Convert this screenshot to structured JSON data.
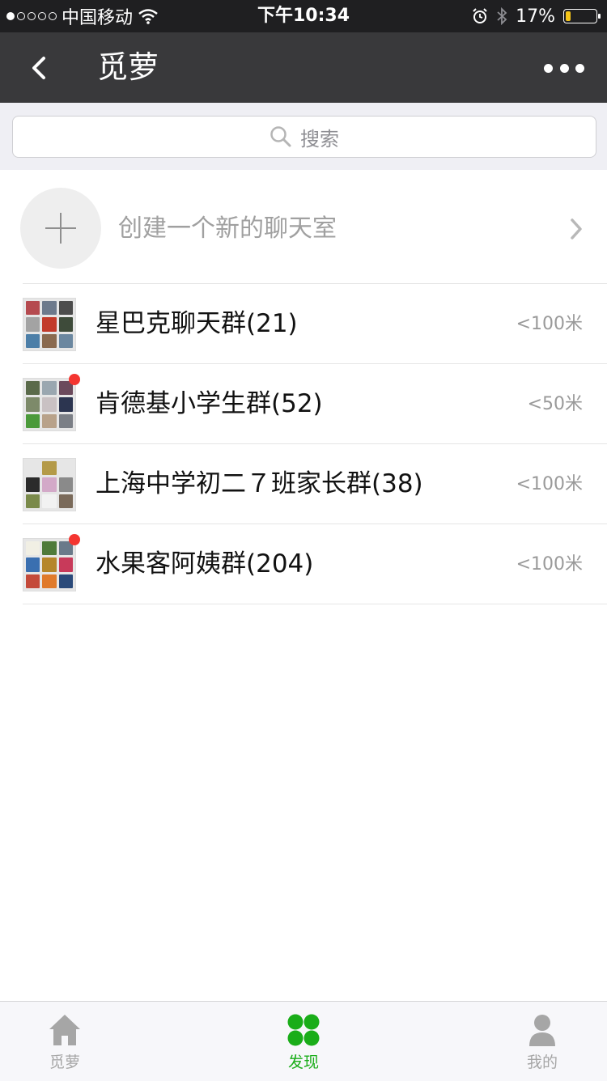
{
  "status_bar": {
    "carrier": "中国移动",
    "time": "下午10:34",
    "battery": "17%",
    "battery_level": 0.17,
    "signal_bars": 1,
    "icons": [
      "wifi-icon",
      "alarm-icon",
      "bluetooth-icon"
    ]
  },
  "nav": {
    "title": "觅萝",
    "back_icon": "chevron-left-icon",
    "more_icon": "more-dots-icon"
  },
  "search": {
    "placeholder": "搜索",
    "icon": "search-icon"
  },
  "create": {
    "label": "创建一个新的聊天室",
    "icon": "plus-icon"
  },
  "groups": [
    {
      "name": "星巴克聊天群(21)",
      "distance": "<100米",
      "unread": false
    },
    {
      "name": "肯德基小学生群(52)",
      "distance": "<50米",
      "unread": true
    },
    {
      "name": "上海中学初二７班家长群(38)",
      "distance": "<100米",
      "unread": false
    },
    {
      "name": "水果客阿姨群(204)",
      "distance": "<100米",
      "unread": true
    }
  ],
  "tabs": [
    {
      "label": "觅萝",
      "icon": "home-icon",
      "active": false
    },
    {
      "label": "发现",
      "icon": "clover-icon",
      "active": true
    },
    {
      "label": "我的",
      "icon": "person-icon",
      "active": false
    }
  ],
  "colors": {
    "nav_bg": "#39393b",
    "accent_green": "#1aad19",
    "unread_red": "#f43530"
  }
}
